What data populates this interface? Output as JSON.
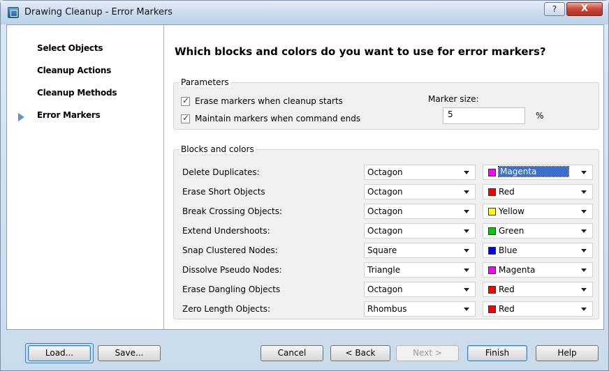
{
  "window": {
    "title": "Drawing Cleanup - Error Markers",
    "help_label": "?",
    "close_label": "X"
  },
  "sidebar": {
    "steps": [
      {
        "label": "Select Objects"
      },
      {
        "label": "Cleanup Actions"
      },
      {
        "label": "Cleanup Methods"
      },
      {
        "label": "Error Markers",
        "current": true
      }
    ]
  },
  "main": {
    "question": "Which blocks and colors do you want to use for error markers?",
    "parameters": {
      "legend": "Parameters",
      "erase_markers": {
        "label": "Erase markers when cleanup starts",
        "checked": true
      },
      "maintain_markers": {
        "label": "Maintain markers when command ends",
        "checked": true
      },
      "marker_size_label": "Marker size:",
      "marker_size_value": "5",
      "marker_size_unit": "%"
    },
    "blocks": {
      "legend": "Blocks and colors",
      "rows": [
        {
          "label": "Delete Duplicates:",
          "block": "Octagon",
          "color": "Magenta",
          "swatch": "#ff00ff",
          "selected": true
        },
        {
          "label": "Erase Short Objects",
          "block": "Octagon",
          "color": "Red",
          "swatch": "#ff0000"
        },
        {
          "label": "Break Crossing Objects:",
          "block": "Octagon",
          "color": "Yellow",
          "swatch": "#ffff00"
        },
        {
          "label": "Extend Undershoots:",
          "block": "Octagon",
          "color": "Green",
          "swatch": "#00cc00"
        },
        {
          "label": "Snap Clustered Nodes:",
          "block": "Square",
          "color": "Blue",
          "swatch": "#0000ff"
        },
        {
          "label": "Dissolve Pseudo Nodes:",
          "block": "Triangle",
          "color": "Magenta",
          "swatch": "#ff00ff"
        },
        {
          "label": "Erase Dangling Objects",
          "block": "Octagon",
          "color": "Red",
          "swatch": "#ff0000"
        },
        {
          "label": "Zero Length Objects:",
          "block": "Rhombus",
          "color": "Red",
          "swatch": "#ff0000"
        }
      ]
    }
  },
  "footer": {
    "load": "Load...",
    "save": "Save...",
    "cancel": "Cancel",
    "back": "< Back",
    "next": "Next >",
    "finish": "Finish",
    "help": "Help"
  }
}
